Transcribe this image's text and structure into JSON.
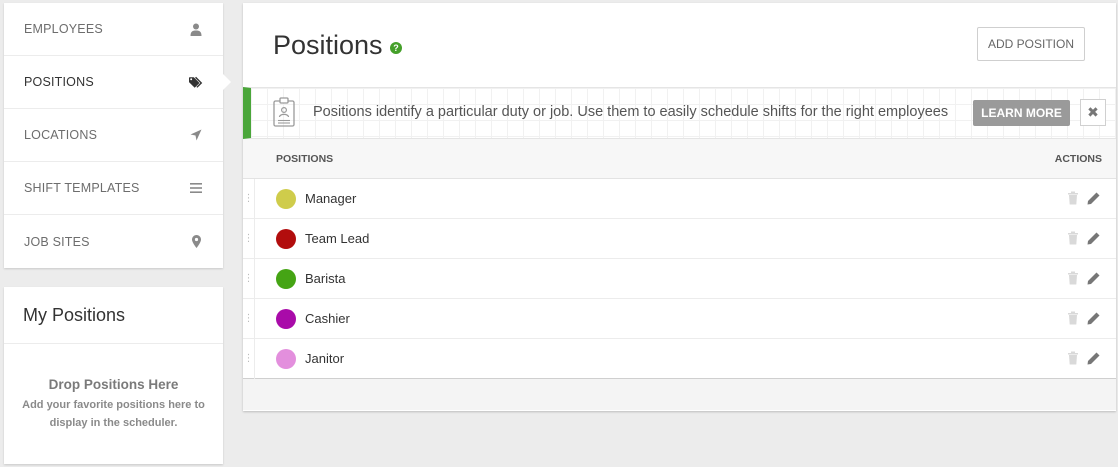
{
  "nav": {
    "items": [
      {
        "label": "EMPLOYEES",
        "icon": "person-icon"
      },
      {
        "label": "POSITIONS",
        "icon": "tags-icon"
      },
      {
        "label": "LOCATIONS",
        "icon": "location-arrow-icon"
      },
      {
        "label": "SHIFT TEMPLATES",
        "icon": "list-icon"
      },
      {
        "label": "JOB SITES",
        "icon": "map-pin-icon"
      }
    ],
    "active": "POSITIONS"
  },
  "my_positions": {
    "title": "My Positions",
    "drop_title": "Drop Positions Here",
    "drop_desc": "Add your favorite positions here to display in the scheduler."
  },
  "main": {
    "title": "Positions",
    "help_glyph": "?",
    "add_button": "ADD POSITION",
    "banner": {
      "text": "Positions identify a particular duty or job. Use them to easily schedule shifts for the right employees",
      "learn_more": "LEARN MORE",
      "close_glyph": "✖",
      "accent_color": "#4aa63a"
    },
    "table": {
      "col_positions": "POSITIONS",
      "col_actions": "ACTIONS",
      "rows": [
        {
          "name": "Manager",
          "color": "#cfcc4b"
        },
        {
          "name": "Team Lead",
          "color": "#b20d0d"
        },
        {
          "name": "Barista",
          "color": "#45a414"
        },
        {
          "name": "Cashier",
          "color": "#a90ba9"
        },
        {
          "name": "Janitor",
          "color": "#e38fdd"
        }
      ]
    }
  }
}
